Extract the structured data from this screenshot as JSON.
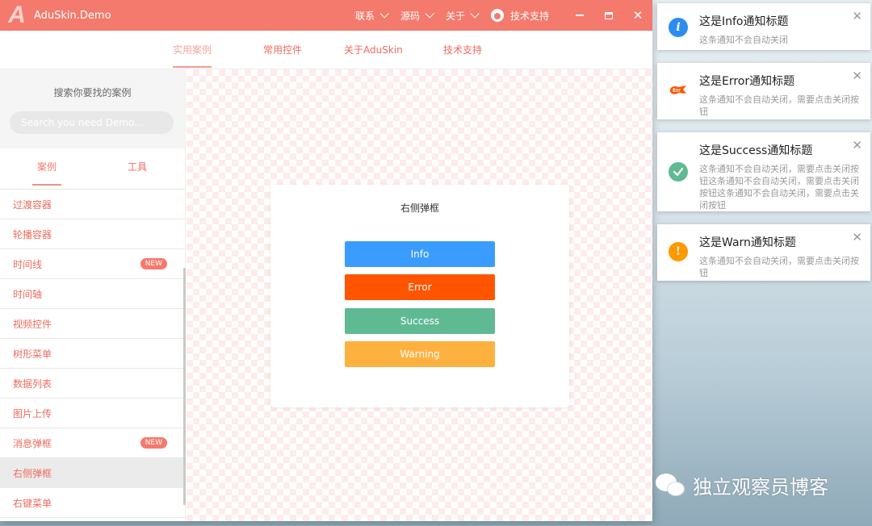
{
  "titlebar": {
    "app_title": "AduSkin.Demo",
    "menu": [
      "联系",
      "源码",
      "关于"
    ],
    "support": "技术支持"
  },
  "tabs": [
    "实用案例",
    "常用控件",
    "关于AduSkin",
    "技术支持"
  ],
  "sidebar": {
    "search_title": "搜索你要找的案例",
    "search_placeholder": "Search you need Demo...",
    "tabs": [
      "案例",
      "工具"
    ],
    "items": [
      {
        "label": "过渡容器",
        "badge": ""
      },
      {
        "label": "轮播容器",
        "badge": ""
      },
      {
        "label": "时间线",
        "badge": "NEW"
      },
      {
        "label": "时间轴",
        "badge": ""
      },
      {
        "label": "视频控件",
        "badge": ""
      },
      {
        "label": "树形菜单",
        "badge": ""
      },
      {
        "label": "数据列表",
        "badge": ""
      },
      {
        "label": "图片上传",
        "badge": ""
      },
      {
        "label": "消息弹框",
        "badge": "NEW"
      },
      {
        "label": "右侧弹框",
        "badge": ""
      },
      {
        "label": "右键菜单",
        "badge": ""
      }
    ],
    "selected_index": 9
  },
  "card": {
    "title": "右侧弹框",
    "buttons": {
      "info": "Info",
      "error": "Error",
      "success": "Success",
      "warning": "Warning"
    }
  },
  "notifications": [
    {
      "type": "info",
      "title": "这是Info通知标题",
      "body": "这条通知不会自动关闭"
    },
    {
      "type": "error",
      "title": "这是Error通知标题",
      "body": "这条通知不会自动关闭，需要点击关闭按钮"
    },
    {
      "type": "success",
      "title": "这是Success通知标题",
      "body": "这条通知不会自动关闭，需要点击关闭按钮这条通知不会自动关闭，需要点击关闭按钮这条通知不会自动关闭，需要点击关闭按钮"
    },
    {
      "type": "warn",
      "title": "这是Warn通知标题",
      "body": "这条通知不会自动关闭，需要点击关闭按钮"
    }
  ],
  "watermark": "独立观察员博客",
  "colors": {
    "brand": "#f37a6c",
    "info": "#3b9cff",
    "error": "#ff5500",
    "success": "#5fba93",
    "warning": "#ffb13f"
  }
}
